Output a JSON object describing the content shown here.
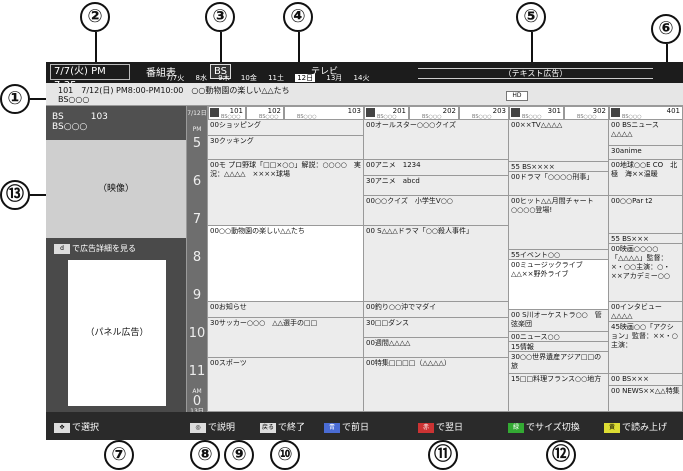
{
  "callouts": [
    "①",
    "②",
    "③",
    "④",
    "⑤",
    "⑥",
    "⑦",
    "⑧",
    "⑨",
    "⑩",
    "⑪",
    "⑫",
    "⑬"
  ],
  "header": {
    "date_time": "7/7(火) PM 7:35",
    "title": "番組表",
    "band": "BS",
    "tv_label": "テレビ",
    "days": [
      "7/7火",
      "8水",
      "9木",
      "10金",
      "11土",
      "12日",
      "13月",
      "14火"
    ],
    "selected_day": "12日",
    "ad_text": "（テキスト広告）"
  },
  "info_bar": {
    "line1": "101　7/12(日) PM8:00-PM10:00　○○動物園の楽しい△△たち",
    "line2": "BS○○○",
    "hd": "HD"
  },
  "left_panel": {
    "ch_label": "BS　　　103",
    "ch_sub": "BS○○○",
    "video": "（映像）",
    "ad_link": "で広告詳細を見る",
    "panel_ad": "（パネル広告）"
  },
  "time_col": {
    "top": "7/12日",
    "pm": "PM",
    "hours": [
      "5",
      "6",
      "7",
      "8",
      "9",
      "10",
      "11",
      "0"
    ],
    "am": "AM",
    "bottom": "13日"
  },
  "channels": [
    {
      "num": "101",
      "name": "",
      "sub": "BS○○○"
    },
    {
      "num": "102",
      "name": "",
      "sub": "BS○○○"
    },
    {
      "num": "103",
      "name": "",
      "sub": "BS○○○"
    },
    {
      "num": "201",
      "name": "",
      "sub": "BS○○○"
    },
    {
      "num": "202",
      "name": "",
      "sub": "BS○○○"
    },
    {
      "num": "203",
      "name": "",
      "sub": "BS○○○"
    },
    {
      "num": "301",
      "name": "",
      "sub": "BS○○○"
    },
    {
      "num": "302",
      "name": "",
      "sub": "BS○○○"
    },
    {
      "num": "401",
      "name": "",
      "sub": "BS○○○"
    }
  ],
  "programs": {
    "c1": [
      "00ショッピング",
      "30クッキング",
      "00モ プロ野球「□□×○○」解説：○○○○　実況：△△△△　××××球場",
      "00○○動物園の楽しい△△たち",
      "00お知らせ",
      "30サッカー○○○　△△選手の□□",
      "00スポーツ"
    ],
    "c2": [
      "00オールスター○○○クイズ",
      "00アニメ　1234",
      "30アニメ　abcd",
      "00○○クイズ　小学生V○○",
      "00 S△△△ドラマ「○○殺人事件」",
      "00釣り○○沖でマダイ",
      "30□□ダンス",
      "00週間△△△△",
      "00特集□□□□（△△△△）"
    ],
    "c3": [
      "00××TV△△△△",
      "55 BS××××",
      "00ドラマ「○○○○刑事」",
      "00ヒット△△月間チャート○○○○登場!",
      "55イベント○○",
      "00ミュージックライブ　△△××野外ライブ",
      "00 S川オーケストラ○○　管弦楽団",
      "00ニュース○○",
      "15情報",
      "30○○世界遺産アジア□□の旅",
      "15□□料理フランス○○地方"
    ],
    "c4": [
      "00 BSニュース△△△△",
      "30anime",
      "00地球○○E CO　北極　海××温暖",
      "00○○Par t2",
      "55 BS×××",
      "00映画○○○○「△△△△」監督：×・○○主演：○・××アカデミー○○",
      "00インタビュー△△△△",
      "45映画○○「アクション」監督：××・○主演：",
      "00 BS×××",
      "00 NEWS××△△特集"
    ]
  },
  "footer": {
    "select": "で選択",
    "explain": "で説明",
    "exit_key": "戻る",
    "exit": "で終了",
    "blue_key": "青",
    "prev_day": "で前日",
    "red_key": "赤",
    "next_day": "で翌日",
    "green_key": "緑",
    "size": "でサイズ切換",
    "yellow_key": "黄",
    "read": "で読み上げ"
  },
  "colors": {
    "screen_bg": "#9a9a9a",
    "header_bg": "#1c1c1c",
    "footer_bg": "#2a2a2a"
  }
}
